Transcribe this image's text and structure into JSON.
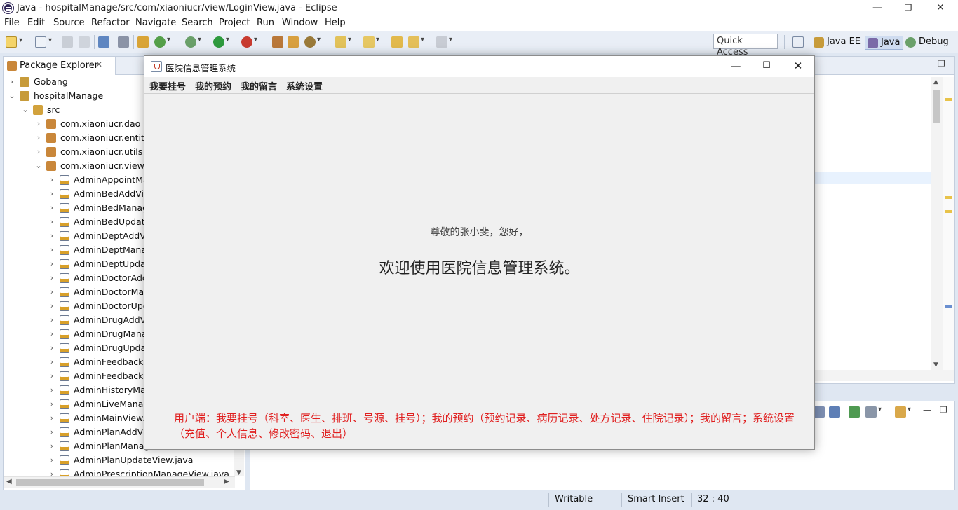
{
  "eclipse": {
    "title": "Java - hospitalManage/src/com/xiaoniucr/view/LoginView.java - Eclipse",
    "menu": [
      "File",
      "Edit",
      "Source",
      "Refactor",
      "Navigate",
      "Search",
      "Project",
      "Run",
      "Window",
      "Help"
    ],
    "quick_access": "Quick Access",
    "perspectives": [
      "Java EE",
      "Java",
      "Debug"
    ]
  },
  "package_explorer": {
    "tab_label": "Package Explorer",
    "tree": [
      {
        "label": "Gobang",
        "depth": 0,
        "expanded": false,
        "kind": "project"
      },
      {
        "label": "hospitalManage",
        "depth": 0,
        "expanded": true,
        "kind": "project"
      },
      {
        "label": "src",
        "depth": 1,
        "expanded": true,
        "kind": "folder"
      },
      {
        "label": "com.xiaoniucr.dao",
        "depth": 2,
        "expanded": false,
        "kind": "package"
      },
      {
        "label": "com.xiaoniucr.entity",
        "depth": 2,
        "expanded": false,
        "kind": "package"
      },
      {
        "label": "com.xiaoniucr.utils",
        "depth": 2,
        "expanded": false,
        "kind": "package"
      },
      {
        "label": "com.xiaoniucr.view",
        "depth": 2,
        "expanded": true,
        "kind": "package"
      },
      {
        "label": "AdminAppointMa",
        "depth": 3,
        "expanded": false,
        "kind": "java"
      },
      {
        "label": "AdminBedAddVie",
        "depth": 3,
        "expanded": false,
        "kind": "java"
      },
      {
        "label": "AdminBedManag",
        "depth": 3,
        "expanded": false,
        "kind": "java"
      },
      {
        "label": "AdminBedUpdate",
        "depth": 3,
        "expanded": false,
        "kind": "java"
      },
      {
        "label": "AdminDeptAddVi",
        "depth": 3,
        "expanded": false,
        "kind": "java"
      },
      {
        "label": "AdminDeptMana",
        "depth": 3,
        "expanded": false,
        "kind": "java"
      },
      {
        "label": "AdminDeptUpdat",
        "depth": 3,
        "expanded": false,
        "kind": "java"
      },
      {
        "label": "AdminDoctorAdd",
        "depth": 3,
        "expanded": false,
        "kind": "java"
      },
      {
        "label": "AdminDoctorMar",
        "depth": 3,
        "expanded": false,
        "kind": "java"
      },
      {
        "label": "AdminDoctorUpc",
        "depth": 3,
        "expanded": false,
        "kind": "java"
      },
      {
        "label": "AdminDrugAddVi",
        "depth": 3,
        "expanded": false,
        "kind": "java"
      },
      {
        "label": "AdminDrugMana",
        "depth": 3,
        "expanded": false,
        "kind": "java"
      },
      {
        "label": "AdminDrugUpdat",
        "depth": 3,
        "expanded": false,
        "kind": "java"
      },
      {
        "label": "AdminFeedbackM",
        "depth": 3,
        "expanded": false,
        "kind": "java"
      },
      {
        "label": "AdminFeedbackR",
        "depth": 3,
        "expanded": false,
        "kind": "java"
      },
      {
        "label": "AdminHistoryMar",
        "depth": 3,
        "expanded": false,
        "kind": "java"
      },
      {
        "label": "AdminLiveManag",
        "depth": 3,
        "expanded": false,
        "kind": "java"
      },
      {
        "label": "AdminMainView.j",
        "depth": 3,
        "expanded": false,
        "kind": "java"
      },
      {
        "label": "AdminPlanAddVie",
        "depth": 3,
        "expanded": false,
        "kind": "java"
      },
      {
        "label": "AdminPlanManag",
        "depth": 3,
        "expanded": false,
        "kind": "java"
      },
      {
        "label": "AdminPlanUpdateView.java",
        "depth": 3,
        "expanded": false,
        "kind": "java"
      },
      {
        "label": "AdminPrescriptionManageView.java",
        "depth": 3,
        "expanded": false,
        "kind": "java"
      }
    ]
  },
  "status": {
    "writable": "Writable",
    "insert_mode": "Smart Insert",
    "cursor": "32 : 40"
  },
  "dialog": {
    "title": "医院信息管理系统",
    "menu": [
      "我要挂号",
      "我的预约",
      "我的留言",
      "系统设置"
    ],
    "greeting": "尊敬的张小斐，您好，",
    "welcome": "欢迎使用医院信息管理系统。",
    "note": "用户端：我要挂号（科室、医生、排班、号源、挂号）；我的预约（预约记录、病历记录、处方记录、住院记录）；我的留言；系统设置（充值、个人信息、修改密码、退出）"
  },
  "colors": {
    "note_red": "#e02020",
    "java_icon": "#d8a02a",
    "package_icon": "#c9873a"
  }
}
